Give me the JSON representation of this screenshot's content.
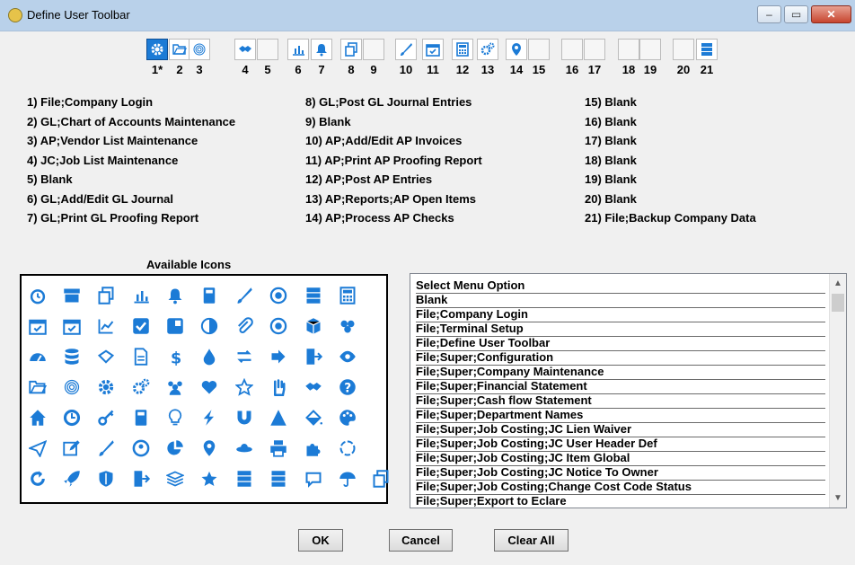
{
  "window": {
    "title": "Define User Toolbar",
    "min_glyph": "–",
    "max_glyph": "▭",
    "close_glyph": "✕"
  },
  "toolbar": {
    "slots": [
      {
        "number": "1*",
        "icon": "gear-icon",
        "selected": true
      },
      {
        "number": "2",
        "icon": "folder-open-icon"
      },
      {
        "number": "3",
        "icon": "fingerprint-icon"
      },
      {
        "number": "4",
        "icon": "handshake-icon"
      },
      {
        "number": "5",
        "icon": ""
      },
      {
        "number": "6",
        "icon": "bar-chart-icon"
      },
      {
        "number": "7",
        "icon": "bell-icon"
      },
      {
        "number": "8",
        "icon": "copy-icon"
      },
      {
        "number": "9",
        "icon": ""
      },
      {
        "number": "10",
        "icon": "paint-brush-icon"
      },
      {
        "number": "11",
        "icon": "calendar-check-icon"
      },
      {
        "number": "12",
        "icon": "calculator-icon"
      },
      {
        "number": "13",
        "icon": "gears-icon"
      },
      {
        "number": "14",
        "icon": "map-marker-icon"
      },
      {
        "number": "15",
        "icon": ""
      },
      {
        "number": "16",
        "icon": ""
      },
      {
        "number": "17",
        "icon": ""
      },
      {
        "number": "18",
        "icon": ""
      },
      {
        "number": "19",
        "icon": ""
      },
      {
        "number": "20",
        "icon": ""
      },
      {
        "number": "21",
        "icon": "server-icon"
      }
    ]
  },
  "assignments": {
    "col1": [
      "1) File;Company Login",
      "2) GL;Chart of Accounts Maintenance",
      "3) AP;Vendor List Maintenance",
      "4) JC;Job List Maintenance",
      "5) Blank",
      "6) GL;Add/Edit GL Journal",
      "7) GL;Print GL Proofing Report"
    ],
    "col2": [
      "8) GL;Post GL Journal Entries",
      "9) Blank",
      "10) AP;Add/Edit AP Invoices",
      "11) AP;Print AP Proofing Report",
      "12) AP;Post AP Entries",
      "13) AP;Reports;AP Open Items",
      "14) AP;Process AP Checks"
    ],
    "col3": [
      "15) Blank",
      "16) Blank",
      "17) Blank",
      "18) Blank",
      "19) Blank",
      "20) Blank",
      "21) File;Backup Company Data"
    ]
  },
  "available_icons": {
    "title": "Available Icons",
    "rows": [
      [
        "alarm-clock-icon",
        "archive-icon",
        "copy-icon",
        "bar-chart-icon",
        "bell-icon",
        "book-icon",
        "paint-brush-icon",
        "bullseye-icon",
        "server-icon",
        "calculator-icon"
      ],
      [
        "calendar-icon",
        "calendar-check-icon",
        "line-chart-icon",
        "check-square-icon",
        "pie-block-icon",
        "contrast-icon",
        "paperclip-icon",
        "crosshairs-icon",
        "cube-icon",
        "cubes-icon"
      ],
      [
        "dashboard-icon",
        "database-icon",
        "diamond-icon",
        "file-text-icon",
        "dollar-icon",
        "droplet-icon",
        "exchange-icon",
        "sign-out-icon",
        "sign-in-icon",
        "eye-icon"
      ],
      [
        "folder-open-icon",
        "fingerprint-icon",
        "gear-icon",
        "gears-icon",
        "group-icon",
        "heart-icon",
        "star-outline-icon",
        "hand-icon",
        "handshake-icon",
        "question-circle-icon"
      ],
      [
        "home-icon",
        "clock-icon",
        "key-icon",
        "calculator-alt-icon",
        "lightbulb-icon",
        "bolt-icon",
        "magnet-icon",
        "triangle-icon",
        "paint-bucket-icon",
        "palette-icon"
      ],
      [
        "paper-plane-icon",
        "edit-icon",
        "pencil-icon",
        "user-circle-icon",
        "pie-chart-icon",
        "map-marker-icon",
        "satellite-icon",
        "print-icon",
        "puzzle-icon",
        "recycle-icon"
      ],
      [
        "refresh-icon",
        "rocket-icon",
        "shield-icon",
        "door-icon",
        "stack-icon",
        "star-icon",
        "list-bars-icon",
        "list-bars-alt-icon",
        "comment-icon",
        "umbrella-icon",
        "clone-icon"
      ]
    ]
  },
  "menu_list": {
    "items": [
      "Select Menu Option",
      "Blank",
      "File;Company Login",
      "File;Terminal Setup",
      "File;Define User Toolbar",
      "File;Super;Configuration",
      "File;Super;Company Maintenance",
      "File;Super;Financial Statement",
      "File;Super;Cash flow Statement",
      "File;Super;Department Names",
      "File;Super;Job Costing;JC Lien Waiver",
      "File;Super;Job Costing;JC User Header Def",
      "File;Super;Job Costing;JC Item Global",
      "File;Super;Job Costing;JC Notice To Owner",
      "File;Super;Job Costing;Change Cost Code Status",
      "File;Super;Export to Eclare"
    ],
    "scroll_up": "▲",
    "scroll_down": "▼"
  },
  "buttons": {
    "ok": "OK",
    "cancel": "Cancel",
    "clear_all": "Clear All"
  },
  "colors": {
    "accent": "#1c7bd6"
  }
}
